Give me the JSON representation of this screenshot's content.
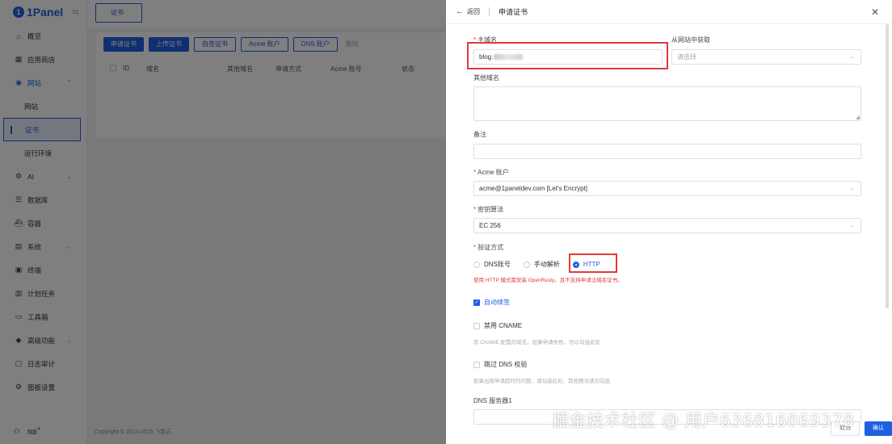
{
  "brand": {
    "name": "1Panel",
    "mark": "1"
  },
  "sidebar": {
    "items": [
      {
        "label": "概览",
        "icon": "home-icon"
      },
      {
        "label": "应用商店",
        "icon": "grid-icon"
      },
      {
        "label": "网站",
        "icon": "globe-icon"
      },
      {
        "label": "网站",
        "icon": ""
      },
      {
        "label": "证书",
        "icon": ""
      },
      {
        "label": "运行环境",
        "icon": ""
      },
      {
        "label": "AI",
        "icon": "robot-icon"
      },
      {
        "label": "数据库",
        "icon": "database-icon"
      },
      {
        "label": "容器",
        "icon": "container-icon"
      },
      {
        "label": "系统",
        "icon": "server-icon"
      },
      {
        "label": "终端",
        "icon": "terminal-icon"
      },
      {
        "label": "计划任务",
        "icon": "list-icon"
      },
      {
        "label": "工具箱",
        "icon": "toolbox-icon"
      },
      {
        "label": "高级功能",
        "icon": "diamond-icon"
      },
      {
        "label": "日志审计",
        "icon": "log-icon"
      },
      {
        "label": "面板设置",
        "icon": "settings-icon"
      }
    ],
    "user": "fit8"
  },
  "main": {
    "tab": "证书",
    "actions": [
      "申请证书",
      "上传证书",
      "自签证书",
      "Acme 账户",
      "DNS 账户",
      "删除"
    ],
    "columns": [
      "ID",
      "域名",
      "其他域名",
      "申请方式",
      "Acme 账号",
      "状态"
    ],
    "copyright": "Copyright © 2014-2025 飞致云"
  },
  "drawer": {
    "back": "返回",
    "title": "申请证书",
    "fields": {
      "primary_domain_label": "主域名",
      "primary_domain_value": "blog.",
      "from_website_label": "从网站中获取",
      "from_website_placeholder": "请选择",
      "other_domains_label": "其他域名",
      "remark_label": "备注",
      "acme_label": "Acme 账户",
      "acme_value": "acme@1paneldev.com [Let's Encrypt]",
      "key_algo_label": "密钥算法",
      "key_algo_value": "EC 256",
      "verify_label": "验证方式",
      "verify_options": [
        "DNS账号",
        "手动解析",
        "HTTP"
      ],
      "verify_selected": "HTTP",
      "http_warning": "使用 HTTP 模式需安装 OpenResty，且不支持申请泛域名证书。",
      "auto_renew_label": "自动续签",
      "auto_renew_checked": true,
      "disable_cname_label": "禁用 CNAME",
      "disable_cname_hint": "有 CNAME 配置的域名，如果申请失败，可以勾选此处",
      "skip_dns_label": "跳过 DNS 校验",
      "skip_dns_hint": "如果出现申请超时的问题，请勾选此处，其他情况请勿勾选",
      "dns_server_label": "DNS 服务器1"
    },
    "cancel": "取消",
    "confirm": "确认"
  },
  "watermark": "掘金技术社区 @ 用户636816869378",
  "colors": {
    "accent": "#1f5fe0",
    "highlight": "#e03b3b",
    "overlay": "rgba(0,0,0,0.5)"
  }
}
